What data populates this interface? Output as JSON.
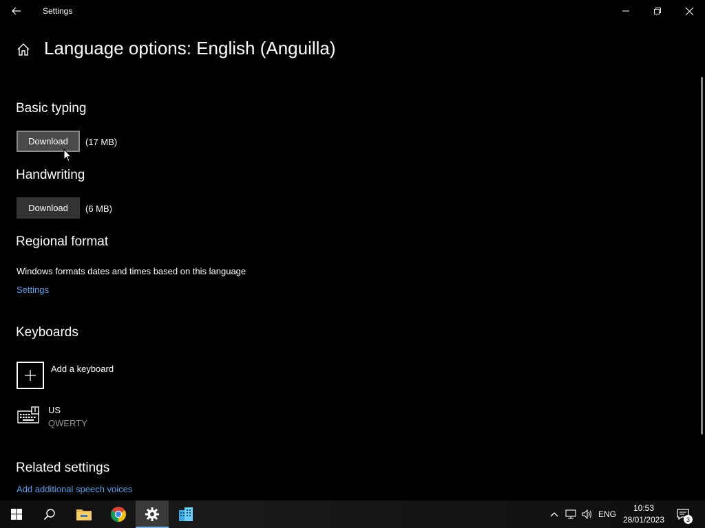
{
  "window": {
    "title": "Settings"
  },
  "page": {
    "title": "Language options: English (Anguilla)"
  },
  "basic_typing": {
    "heading": "Basic typing",
    "button_label": "Download",
    "size": "(17 MB)"
  },
  "handwriting": {
    "heading": "Handwriting",
    "button_label": "Download",
    "size": "(6 MB)"
  },
  "regional_format": {
    "heading": "Regional format",
    "description": "Windows formats dates and times based on this language",
    "link": "Settings"
  },
  "keyboards": {
    "heading": "Keyboards",
    "add_label": "Add a keyboard",
    "items": [
      {
        "name": "US",
        "layout": "QWERTY",
        "icon": "keyboard-icon"
      }
    ]
  },
  "related_settings": {
    "heading": "Related settings",
    "link": "Add additional speech voices"
  },
  "taskbar": {
    "apps": [
      {
        "name": "start",
        "icon": "windows-logo-icon"
      },
      {
        "name": "search",
        "icon": "search-icon"
      },
      {
        "name": "file-explorer",
        "icon": "folder-icon"
      },
      {
        "name": "chrome",
        "icon": "chrome-icon"
      },
      {
        "name": "settings",
        "icon": "gear-icon",
        "active": true
      },
      {
        "name": "app",
        "icon": "building-icon"
      }
    ],
    "language": "ENG",
    "time": "10:53",
    "date": "28/01/2023",
    "notification_count": "3"
  },
  "colors": {
    "link": "#4ca3f0",
    "active_indicator": "#7ab4ea"
  }
}
